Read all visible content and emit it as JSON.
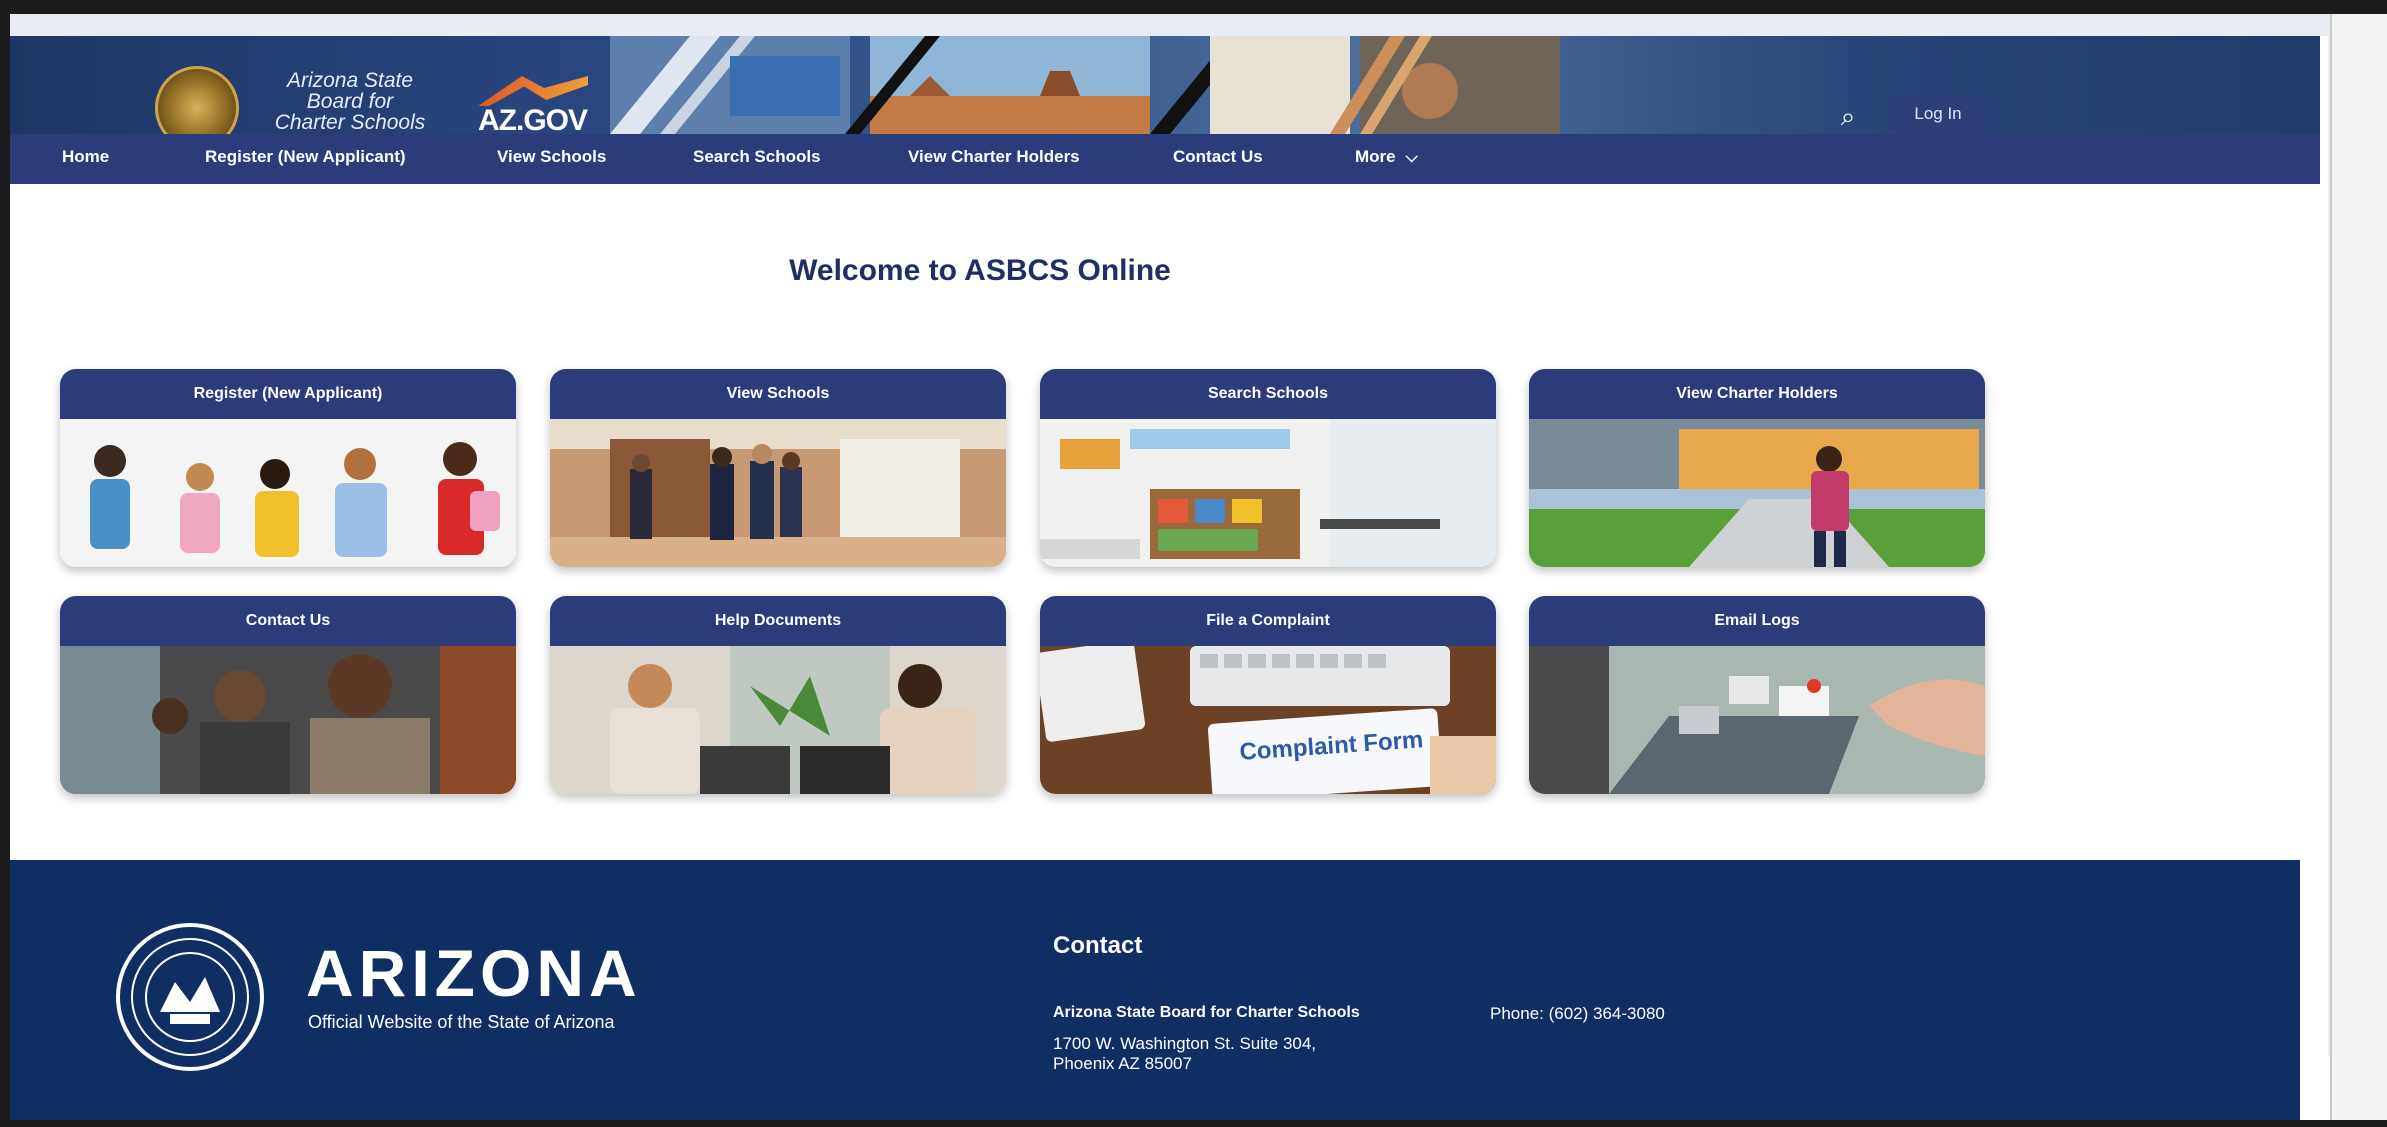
{
  "header": {
    "brand_line1": "Arizona State",
    "brand_line2": "Board for",
    "brand_line3": "Charter Schools",
    "azgov_text": "AZ.GOV",
    "login_label": "Log In"
  },
  "nav": {
    "items": [
      {
        "label": "Home"
      },
      {
        "label": "Register (New Applicant)"
      },
      {
        "label": "View Schools"
      },
      {
        "label": "Search Schools"
      },
      {
        "label": "View Charter Holders"
      },
      {
        "label": "Contact Us"
      },
      {
        "label": "More"
      }
    ]
  },
  "main": {
    "welcome": "Welcome to ASBCS Online",
    "tiles": [
      {
        "title": "Register (New Applicant)"
      },
      {
        "title": "View Schools"
      },
      {
        "title": "Search Schools"
      },
      {
        "title": "View Charter Holders"
      },
      {
        "title": "Contact Us"
      },
      {
        "title": "Help Documents"
      },
      {
        "title": "File a Complaint",
        "image_text": "Complaint Form"
      },
      {
        "title": "Email Logs"
      }
    ]
  },
  "footer": {
    "state_word": "ARIZONA",
    "state_sub": "Official Website of the State of Arizona",
    "contact_title": "Contact",
    "org": "Arizona State Board for Charter Schools",
    "address_line1": "1700 W. Washington St. Suite 304,",
    "address_line2": "Phoenix AZ 85007",
    "phone": "Phone: (602) 364-3080"
  },
  "colors": {
    "navy": "#2c3c7b",
    "footer_navy": "#0f2e63",
    "heading": "#1f2f66"
  }
}
